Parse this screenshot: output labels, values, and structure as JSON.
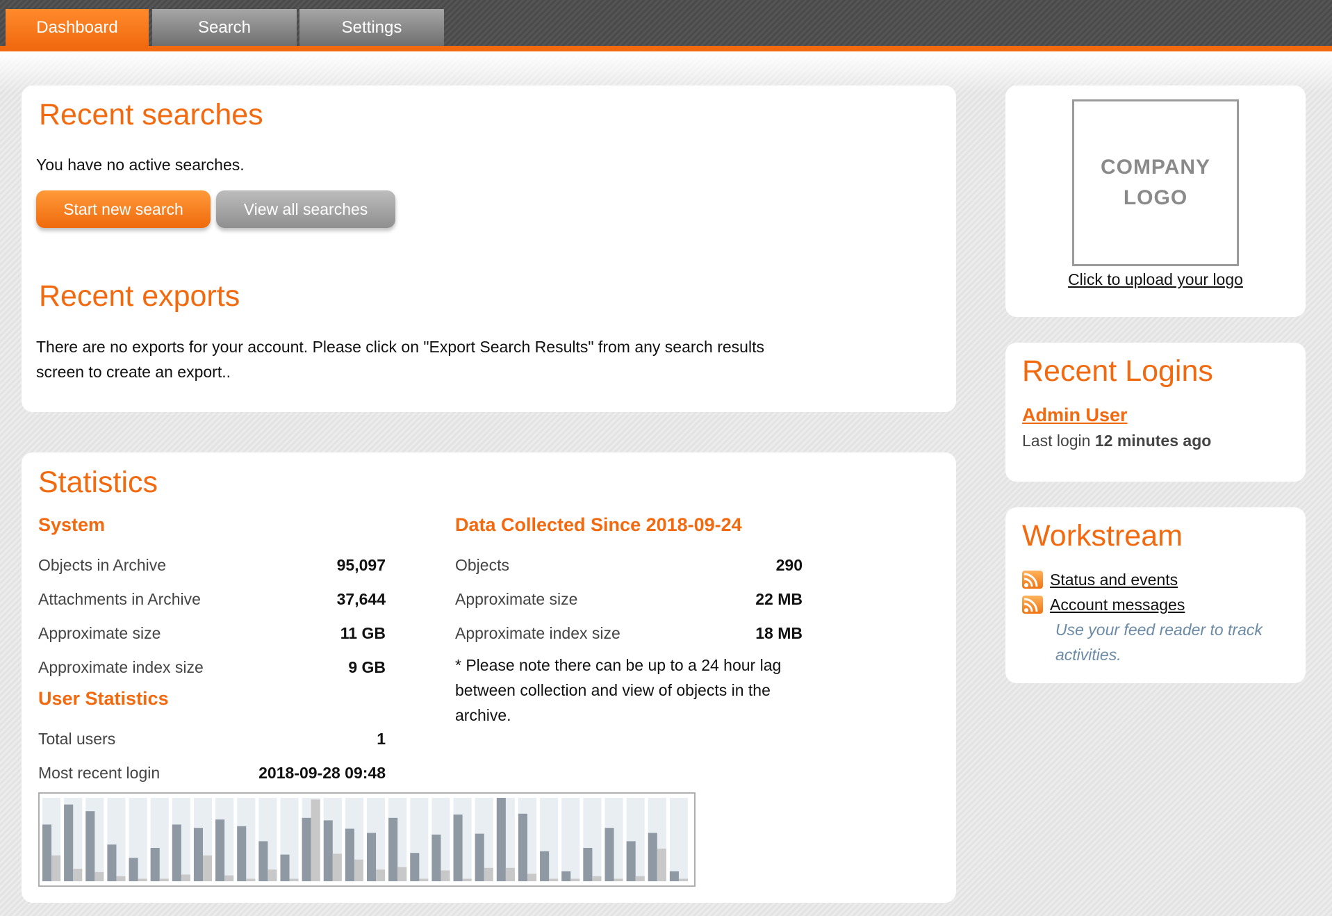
{
  "nav": {
    "tabs": [
      {
        "label": "Dashboard",
        "active": true
      },
      {
        "label": "Search",
        "active": false
      },
      {
        "label": "Settings",
        "active": false
      }
    ]
  },
  "recent_searches": {
    "title": "Recent searches",
    "empty_text": "You have no active searches.",
    "start_button": "Start new search",
    "view_button": "View all searches"
  },
  "recent_exports": {
    "title": "Recent exports",
    "line1": "There are no exports for your account. Please click on \"Export Search Results\" from any search results",
    "line2": "screen to create an export.."
  },
  "statistics": {
    "title": "Statistics",
    "system": {
      "heading": "System",
      "rows": [
        {
          "label": "Objects in Archive",
          "value": "95,097"
        },
        {
          "label": "Attachments in Archive",
          "value": "37,644"
        },
        {
          "label": "Approximate size",
          "value": "11 GB"
        },
        {
          "label": "Approximate index size",
          "value": "9 GB"
        }
      ]
    },
    "user_stats": {
      "heading": "User Statistics",
      "rows": [
        {
          "label": "Total users",
          "value": "1"
        },
        {
          "label": "Most recent login",
          "value": "2018-09-28 09:48"
        }
      ]
    },
    "collected": {
      "heading": "Data Collected Since 2018-09-24",
      "rows": [
        {
          "label": "Objects",
          "value": "290"
        },
        {
          "label": "Approximate size",
          "value": "22 MB"
        },
        {
          "label": "Approximate index size",
          "value": "18 MB"
        }
      ],
      "note_lines": [
        "* Please note there can be up to a 24 hour lag",
        "between collection and view of objects in the",
        "archive."
      ]
    }
  },
  "chart_data": {
    "type": "bar",
    "grid": false,
    "series": [
      {
        "color": "#8e99a4",
        "values": [
          68,
          92,
          84,
          44,
          28,
          40,
          68,
          64,
          74,
          66,
          48,
          32,
          76,
          73,
          63,
          58,
          76,
          34,
          56,
          80,
          57,
          100,
          81,
          36,
          12,
          40,
          64,
          48,
          58,
          12
        ]
      },
      {
        "color": "#c8c8c8",
        "values": [
          31,
          15,
          11,
          6,
          3,
          3,
          8,
          31,
          7,
          3,
          14,
          3,
          98,
          33,
          26,
          14,
          17,
          3,
          13,
          3,
          16,
          16,
          9,
          3,
          3,
          6,
          3,
          6,
          39,
          3
        ]
      }
    ],
    "ylim": [
      0,
      100
    ],
    "colors": {
      "track": "#e9eef3"
    }
  },
  "logo": {
    "line1": "COMPANY",
    "line2": "LOGO",
    "upload_link": "Click to upload your logo"
  },
  "recent_logins": {
    "title": "Recent Logins",
    "user": "Admin User",
    "last_login_prefix": "Last login",
    "last_login_value": "12 minutes ago"
  },
  "workstream": {
    "title": "Workstream",
    "links": [
      {
        "label": "Status and events",
        "icon": "rss-feed-icon"
      },
      {
        "label": "Account messages",
        "icon": "rss-feed-icon"
      }
    ],
    "hint_line1": "Use your feed reader to track",
    "hint_line2": "activities."
  },
  "colors": {
    "accent": "#f26a10",
    "hint": "#6b8aa6"
  }
}
